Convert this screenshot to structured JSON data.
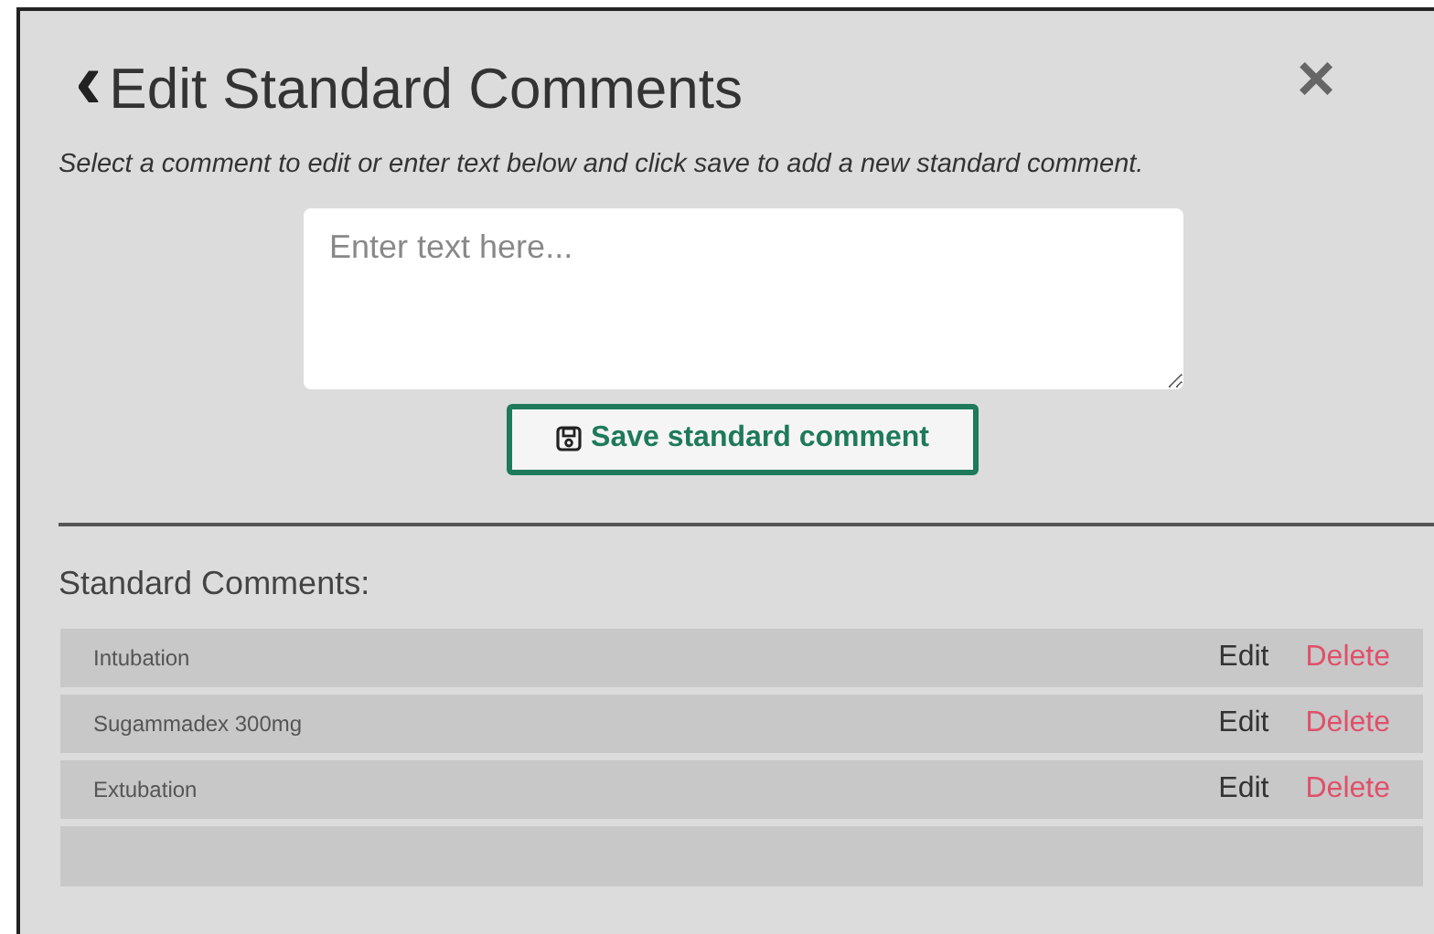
{
  "header": {
    "back": "‹",
    "title": "Edit Standard Comments",
    "close": "×"
  },
  "instructions": "Select a comment to edit or enter text below and click save to add a new standard comment.",
  "comment_input": {
    "placeholder": "Enter text here..."
  },
  "save_button": "Save standard comment",
  "list_title": "Standard Comments:",
  "comments": [
    {
      "text": "Intubation",
      "edit": "Edit",
      "delete": "Delete"
    },
    {
      "text": "Sugammadex 300mg",
      "edit": "Edit",
      "delete": "Delete"
    },
    {
      "text": "Extubation",
      "edit": "Edit",
      "delete": "Delete"
    }
  ]
}
